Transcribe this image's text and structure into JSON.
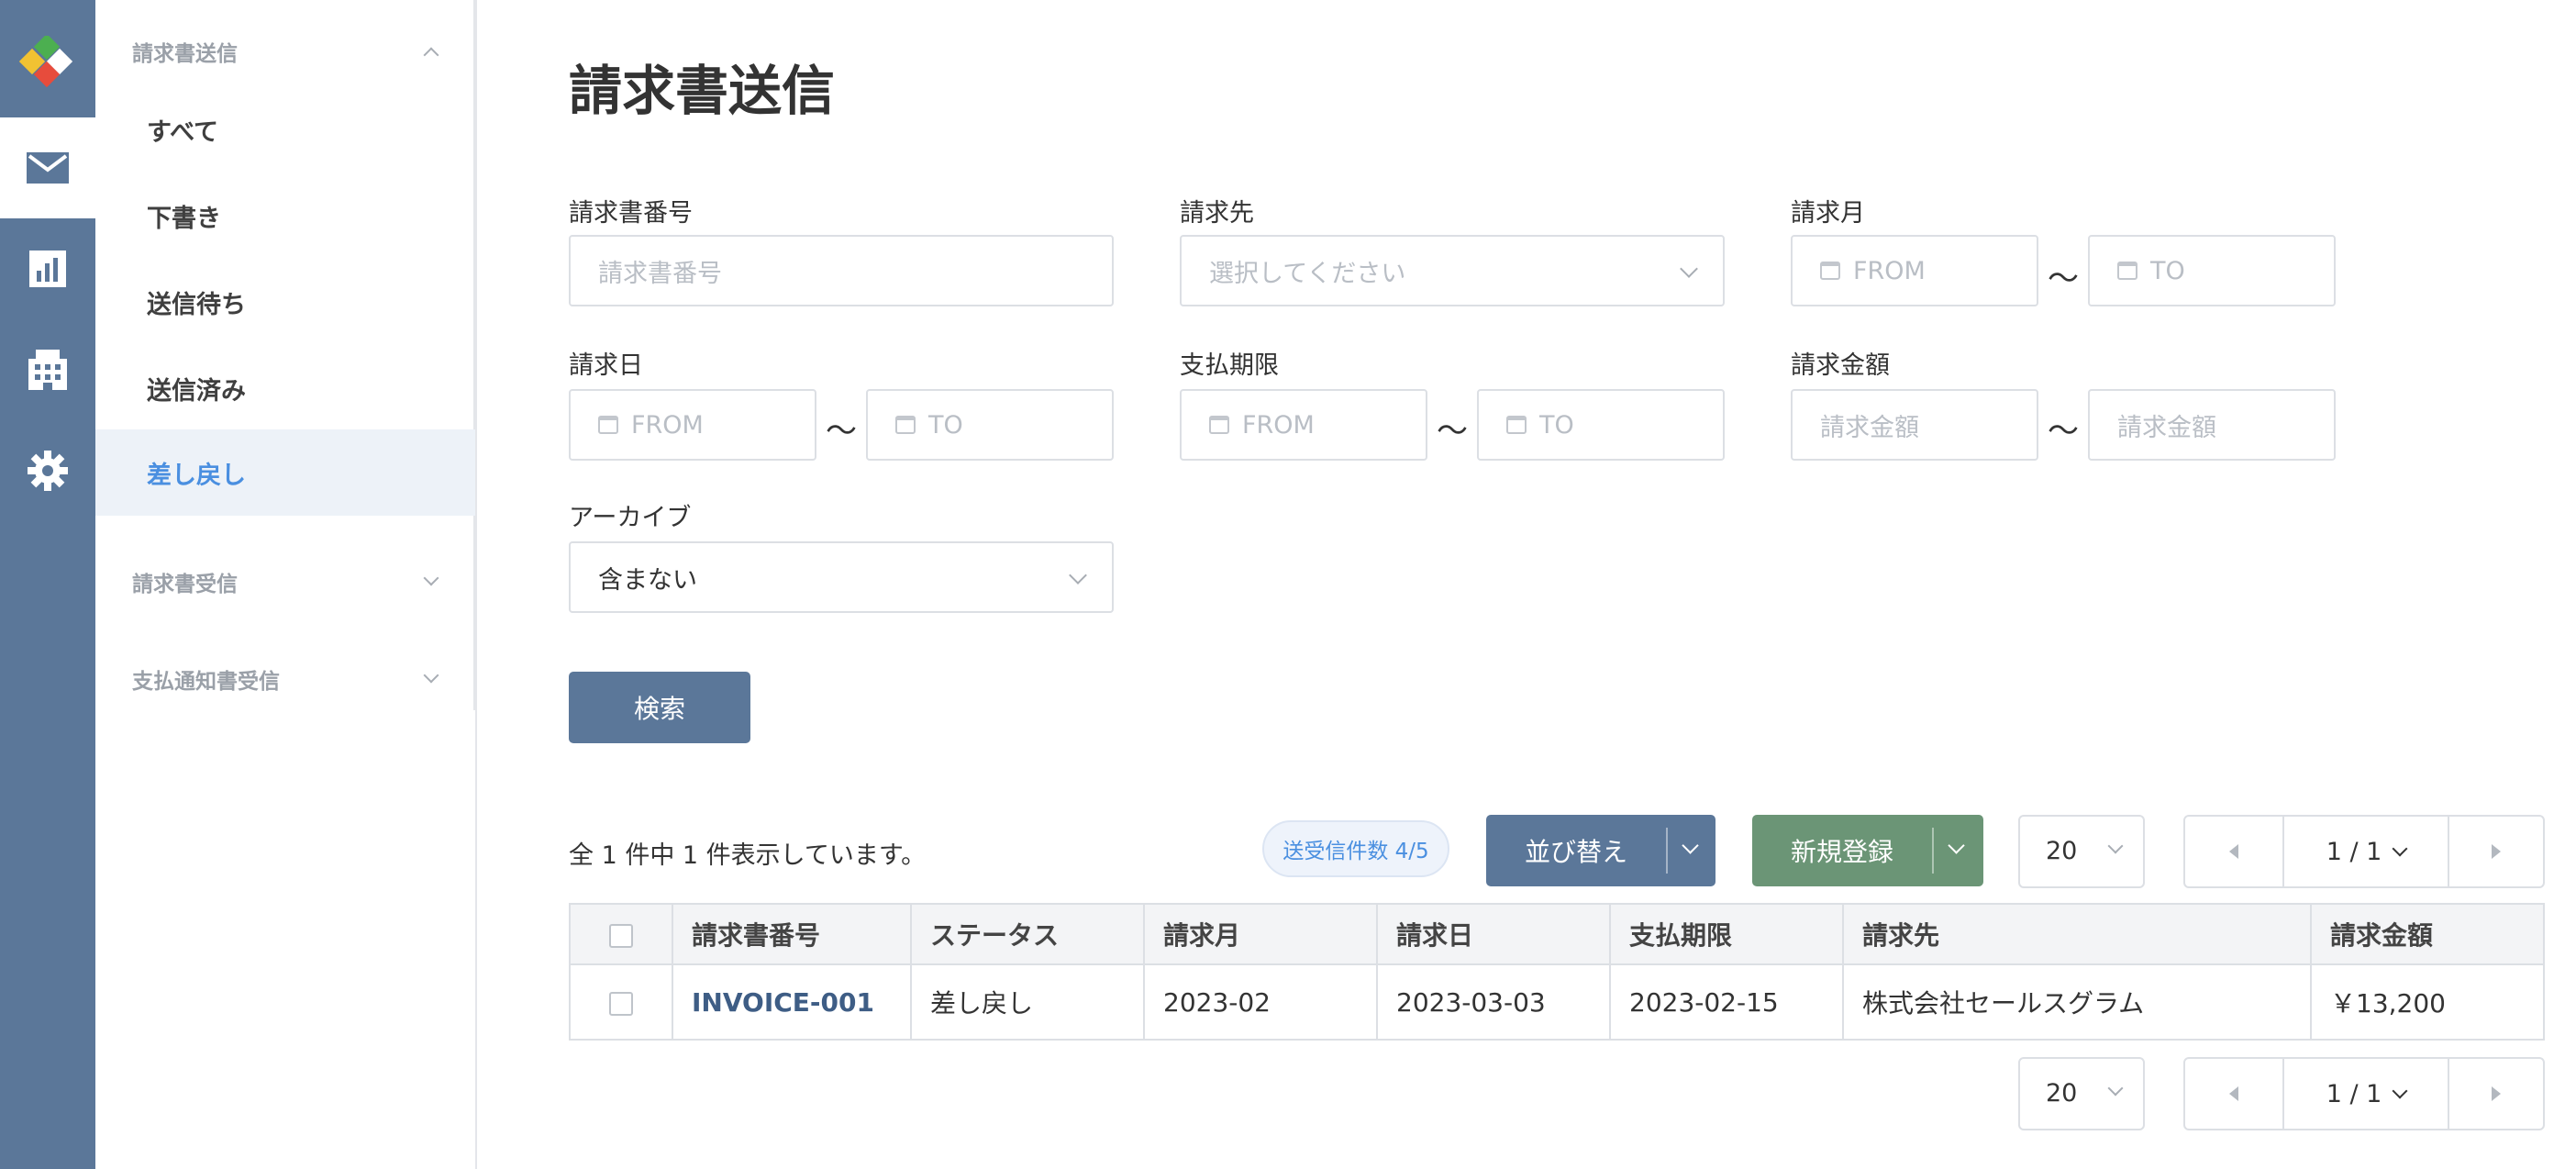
{
  "nav": {
    "rail": [
      "logo-icon",
      "mail-icon",
      "chart-icon",
      "building-icon",
      "gear-icon"
    ],
    "groups": [
      {
        "label": "請求書送信",
        "items": [
          "すべて",
          "下書き",
          "送信待ち",
          "送信済み",
          "差し戻し"
        ],
        "active": "差し戻し"
      },
      {
        "label": "請求書受信"
      },
      {
        "label": "支払通知書受信"
      }
    ]
  },
  "page": {
    "title": "請求書送信"
  },
  "filters": {
    "invoice_no": {
      "label": "請求書番号",
      "placeholder": "請求書番号"
    },
    "recipient": {
      "label": "請求先",
      "placeholder": "選択してください"
    },
    "billing_month": {
      "label": "請求月",
      "from": "FROM",
      "to": "TO"
    },
    "billing_date": {
      "label": "請求日",
      "from": "FROM",
      "to": "TO"
    },
    "due_date": {
      "label": "支払期限",
      "from": "FROM",
      "to": "TO"
    },
    "amount": {
      "label": "請求金額",
      "from": "請求金額",
      "to": "請求金額"
    },
    "archive": {
      "label": "アーカイブ",
      "value": "含まない"
    },
    "tilde": "〜",
    "search_button": "検索"
  },
  "results": {
    "summary": "全 1 件中 1 件表示しています。",
    "badge": "送受信件数 4/5",
    "sort_button": "並び替え",
    "new_button": "新規登録",
    "per_page": "20",
    "page": "1 / 1",
    "columns": [
      "請求書番号",
      "ステータス",
      "請求月",
      "請求日",
      "支払期限",
      "請求先",
      "請求金額"
    ],
    "rows": [
      {
        "invoice_no": "INVOICE-001",
        "status": "差し戻し",
        "month": "2023-02",
        "date": "2023-03-03",
        "due": "2023-02-15",
        "recipient": "株式会社セールスグラム",
        "amount": "￥13,200"
      }
    ]
  },
  "colors": {
    "rail": "#5b7799",
    "primary_button": "#5b7799",
    "new_button": "#6b9576",
    "accent": "#4a8fe0"
  }
}
